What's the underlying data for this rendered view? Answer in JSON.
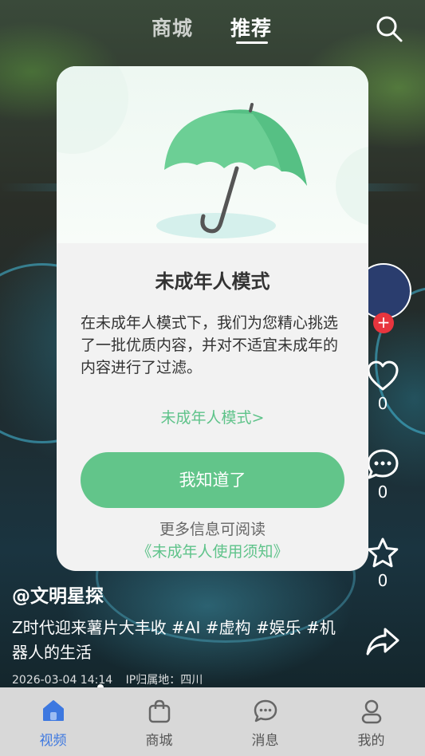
{
  "top_tabs": [
    {
      "label": "商城"
    },
    {
      "label": "推荐"
    }
  ],
  "side_actions": {
    "like_count": "0",
    "comment_count": "0",
    "favorite_count": "0",
    "follow_label": "+"
  },
  "video": {
    "author": "@文明星探",
    "caption": "Z时代迎来薯片大丰收  #AI #虚构 #娱乐 #机器人的生活",
    "date": "2026-03-04 14:14",
    "ip_location": "IP归属地：四川"
  },
  "modal": {
    "title": "未成年人模式",
    "body": "在未成年人模式下，我们为您精心挑选了一批优质内容，并对不适宜未成年的内容进行了过滤。",
    "mode_link": "未成年人模式>",
    "confirm_label": "我知道了",
    "more_info": "更多信息可阅读",
    "terms_link": "《未成年人使用须知》"
  },
  "bottom_nav": [
    {
      "label": "视频",
      "icon": "home-icon",
      "active": true
    },
    {
      "label": "商城",
      "icon": "shopping-bag-icon",
      "active": false
    },
    {
      "label": "消息",
      "icon": "message-icon",
      "active": false
    },
    {
      "label": "我的",
      "icon": "person-icon",
      "active": false
    }
  ],
  "colors": {
    "accent_green": "#62c58a",
    "active_blue": "#3d78e0",
    "follow_red": "#e8353e"
  }
}
